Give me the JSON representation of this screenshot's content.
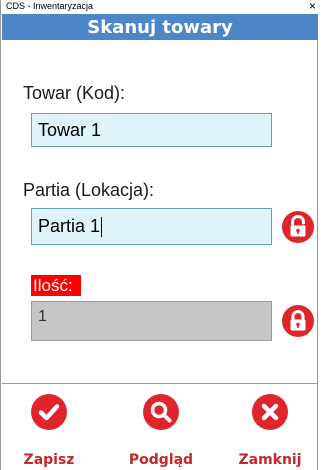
{
  "window": {
    "title": "CDS - Inwentaryzacja",
    "close_glyph": "×"
  },
  "header": {
    "title": "Skanuj towary",
    "color": "#4a86c8"
  },
  "form": {
    "towar": {
      "label": "Towar (Kod):",
      "value": "Towar 1"
    },
    "partia": {
      "label": "Partia (Lokacja):",
      "value": "Partia 1",
      "lock_icon": "lock-open-icon"
    },
    "ilosc": {
      "label": "Ilość:",
      "value": "1",
      "lock_icon": "lock-closed-icon"
    }
  },
  "actions": [
    {
      "label": "Zapisz",
      "icon": "checkmark-icon"
    },
    {
      "label": "Podgląd",
      "icon": "magnifier-icon"
    },
    {
      "label": "Zamknij",
      "icon": "close-x-icon"
    }
  ],
  "colors": {
    "accent": "#e0242c",
    "field_background": "#dff3fb",
    "disabled_field": "#c6c6c6",
    "label_highlight": "#ff0000"
  }
}
